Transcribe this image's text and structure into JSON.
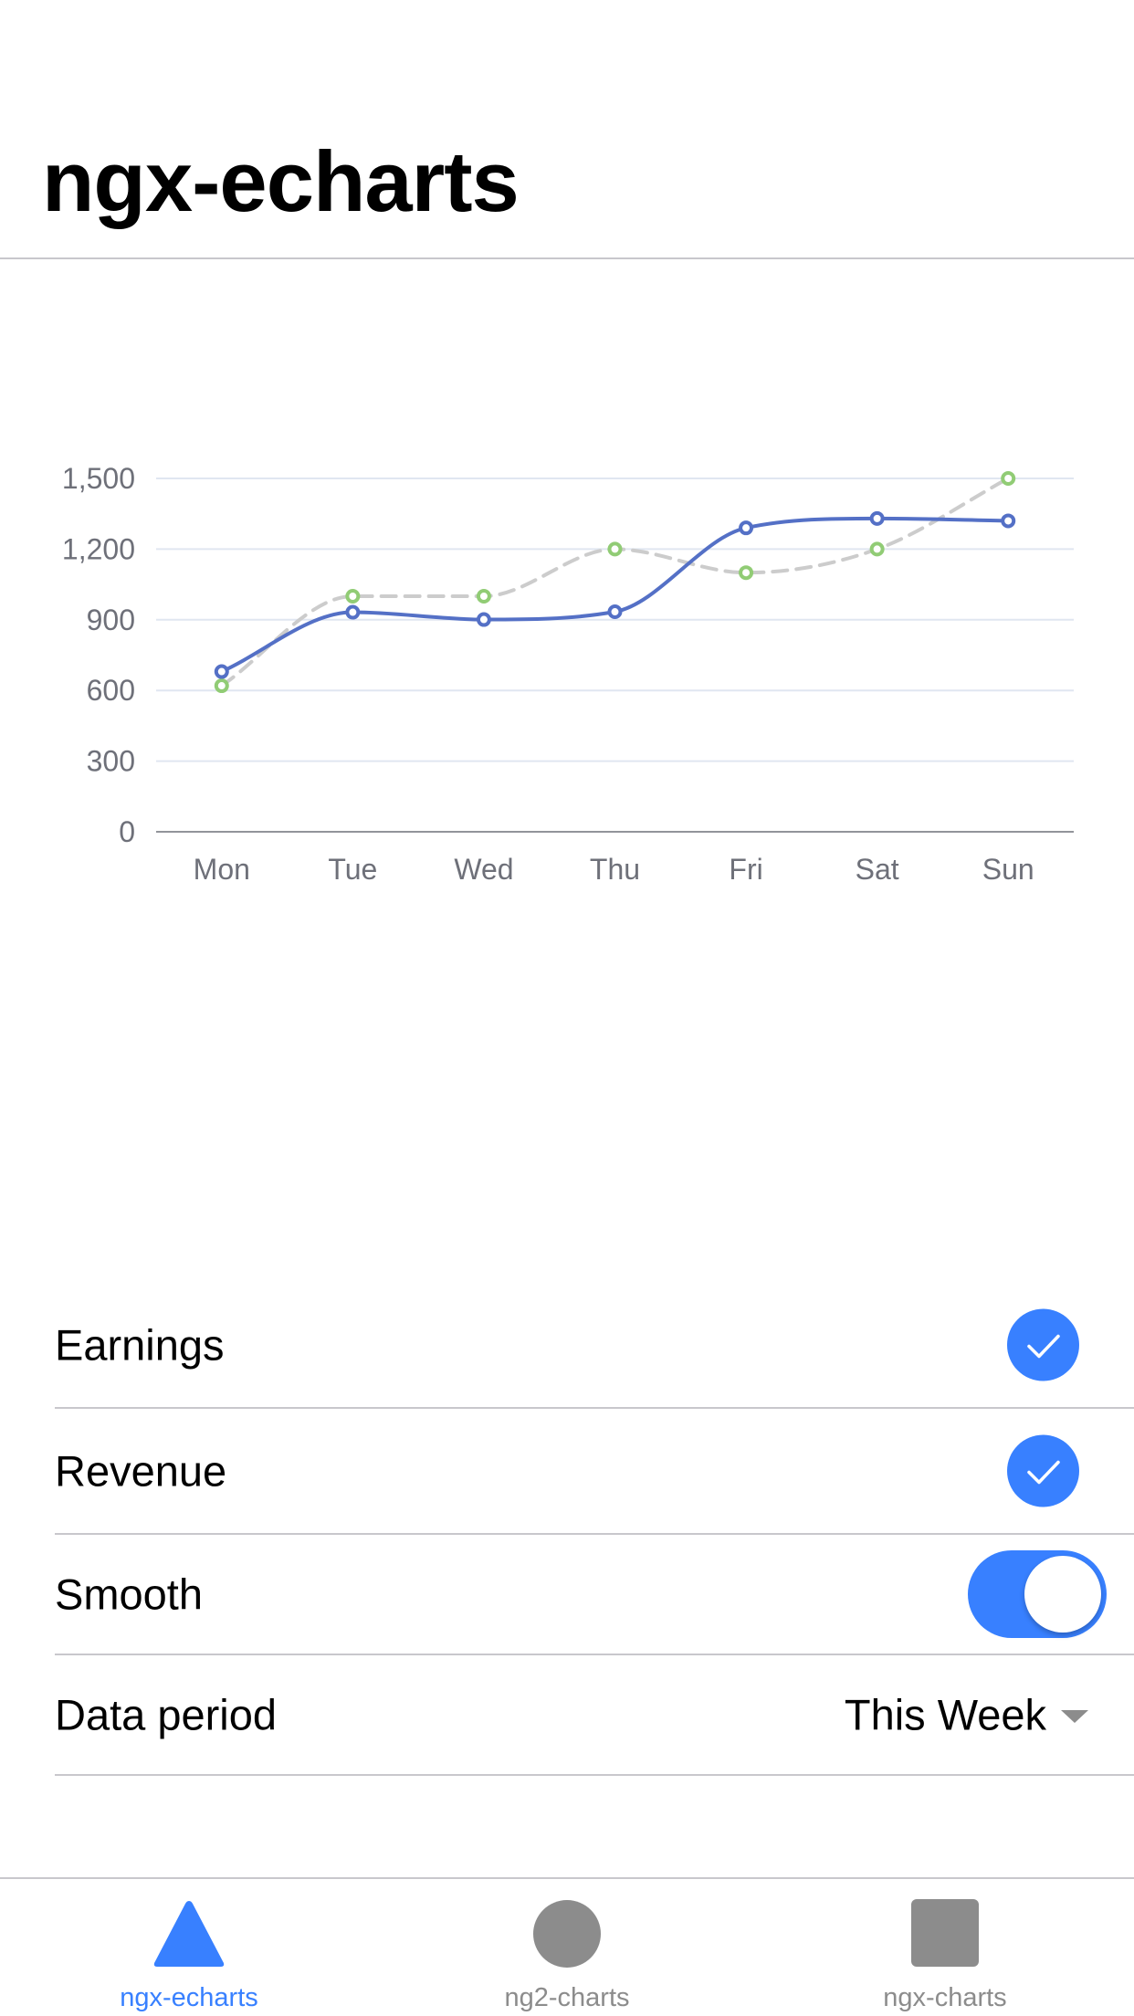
{
  "header": {
    "title": "ngx-echarts"
  },
  "chart_data": {
    "type": "line",
    "categories": [
      "Mon",
      "Tue",
      "Wed",
      "Thu",
      "Fri",
      "Sat",
      "Sun"
    ],
    "series": [
      {
        "values": [
          680,
          932,
          901,
          934,
          1290,
          1330,
          1320
        ],
        "color": "#5470c6",
        "style": "solid"
      },
      {
        "values": [
          620,
          1000,
          1000,
          1200,
          1100,
          1200,
          1500
        ],
        "color": "#91cc75",
        "line_color": "#cccccc",
        "style": "dashed"
      }
    ],
    "y_ticks": [
      "0",
      "300",
      "600",
      "900",
      "1,200",
      "1,500"
    ],
    "ylim": [
      0,
      1500
    ],
    "smooth": true,
    "grid": true
  },
  "settings": {
    "earnings_label": "Earnings",
    "earnings_checked": true,
    "revenue_label": "Revenue",
    "revenue_checked": true,
    "smooth_label": "Smooth",
    "smooth_on": true,
    "period_label": "Data period",
    "period_value": "This Week"
  },
  "tabs": [
    {
      "label": "ngx-echarts",
      "icon": "triangle-icon",
      "active": true
    },
    {
      "label": "ng2-charts",
      "icon": "circle-icon",
      "active": false
    },
    {
      "label": "ngx-charts",
      "icon": "square-icon",
      "active": false
    }
  ],
  "colors": {
    "accent": "#3880ff",
    "inactive": "#8c8c8c",
    "divider": "#c8c7cc"
  }
}
